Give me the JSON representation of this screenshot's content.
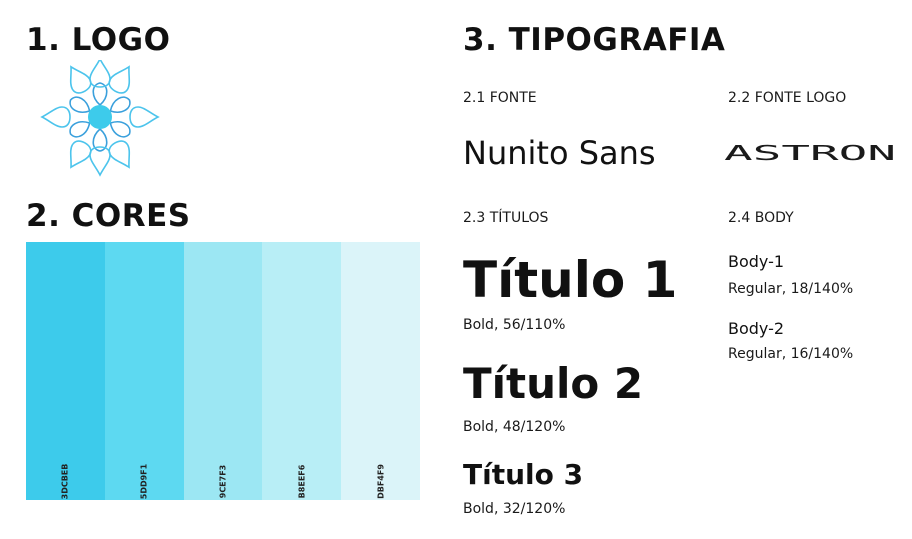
{
  "logo_section": {
    "title": "1. LOGO"
  },
  "colors_section": {
    "title": "2. CORES",
    "swatches": [
      {
        "hex": "#3DCBEB",
        "code": "3DCBEB"
      },
      {
        "hex": "#5DD9F1",
        "code": "5DD9F1"
      },
      {
        "hex": "#9CE7F3",
        "code": "9CE7F3"
      },
      {
        "hex": "#B8EEF6",
        "code": "B8EEF6"
      },
      {
        "hex": "#DBF4F9",
        "code": "DBF4F9"
      }
    ]
  },
  "typography_section": {
    "title": "3. TIPOGRAFIA",
    "font": {
      "label": "2.1 FONTE",
      "name": "Nunito Sans"
    },
    "logo_font": {
      "label": "2.2 FONTE LOGO",
      "wordmark": "ASTRON"
    },
    "titles": {
      "label": "2.3 TÍTULOS",
      "items": [
        {
          "name": "Título 1",
          "spec": "Bold, 56/110%"
        },
        {
          "name": "Título 2",
          "spec": "Bold, 48/120%"
        },
        {
          "name": "Título 3",
          "spec": "Bold, 32/120%"
        }
      ]
    },
    "body": {
      "label": "2.4 BODY",
      "items": [
        {
          "name": "Body-1",
          "spec": "Regular, 18/140%"
        },
        {
          "name": "Body-2",
          "spec": "Regular, 16/140%"
        }
      ]
    }
  },
  "colors": {
    "logo_outline": "#3aa0dc",
    "logo_center": "#3dcbeb",
    "text": "#111111"
  }
}
